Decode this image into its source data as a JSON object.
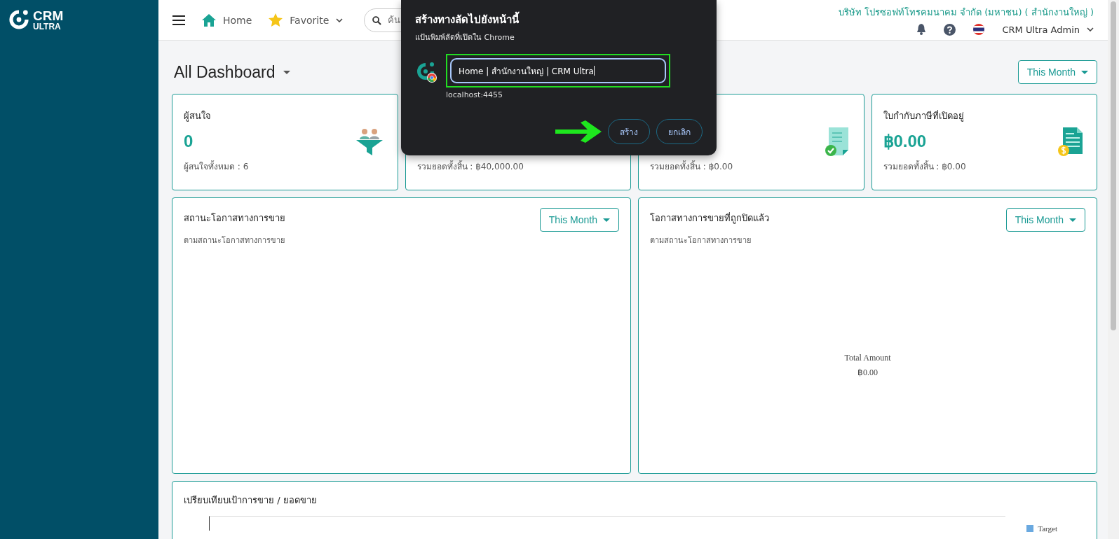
{
  "sidebar": {
    "logo": {
      "line_1": "CRM",
      "line_2": "ULTRA"
    }
  },
  "header": {
    "home": "Home",
    "favorite": "Favorite",
    "search": {
      "placeholder": "ค้น"
    },
    "company": "บริษัท โปรซอฟท์โทรคมนาคม จำกัด (มหาชน) ( สำนักงานใหญ่ )",
    "user": "CRM Ultra Admin"
  },
  "page": {
    "title": "All Dashboard",
    "period_button": "This Month"
  },
  "cards": [
    {
      "kind": "leads",
      "title": "ผู้สนใจ",
      "value": "0",
      "footer": "ผู้สนใจทั้งหมด : 6"
    },
    {
      "kind": "covered",
      "footer": "รวมยอดทั้งสิ้น : ฿40,000.00"
    },
    {
      "kind": "approved",
      "footer": "รวมยอดทั้งสิ้น : ฿0.00"
    },
    {
      "kind": "invoice",
      "title": "ใบกำกับภาษีที่เปิดอยู่",
      "value": "฿0.00",
      "footer": "รวมยอดทั้งสิ้น : ฿0.00"
    }
  ],
  "panels": [
    {
      "title": "สถานะโอกาสทางการขาย",
      "subtitle": "ตามสถานะโอกาสทางการขาย",
      "period_button": "This Month"
    },
    {
      "title": "โอกาสทางการขายที่ถูกปิดแล้ว",
      "subtitle": "ตามสถานะโอกาสทางการขาย",
      "period_button": "This Month",
      "center_label": "Total Amount",
      "center_value": "฿0.00"
    }
  ],
  "comparison": {
    "title": "เปรียบเทียบเป้าการขาย / ยอดขาย",
    "legend": [
      "Target"
    ]
  },
  "dialog": {
    "title": "สร้างทางลัดไปยังหน้านี้",
    "subtitle": "แป้นพิมพ์ลัดที่เปิดใน Chrome",
    "name_value": "Home | สำนักงานใหญ่ | CRM Ultra",
    "url": "localhost:4455",
    "buttons": [
      "สร้าง",
      "ยกเลิก"
    ]
  }
}
